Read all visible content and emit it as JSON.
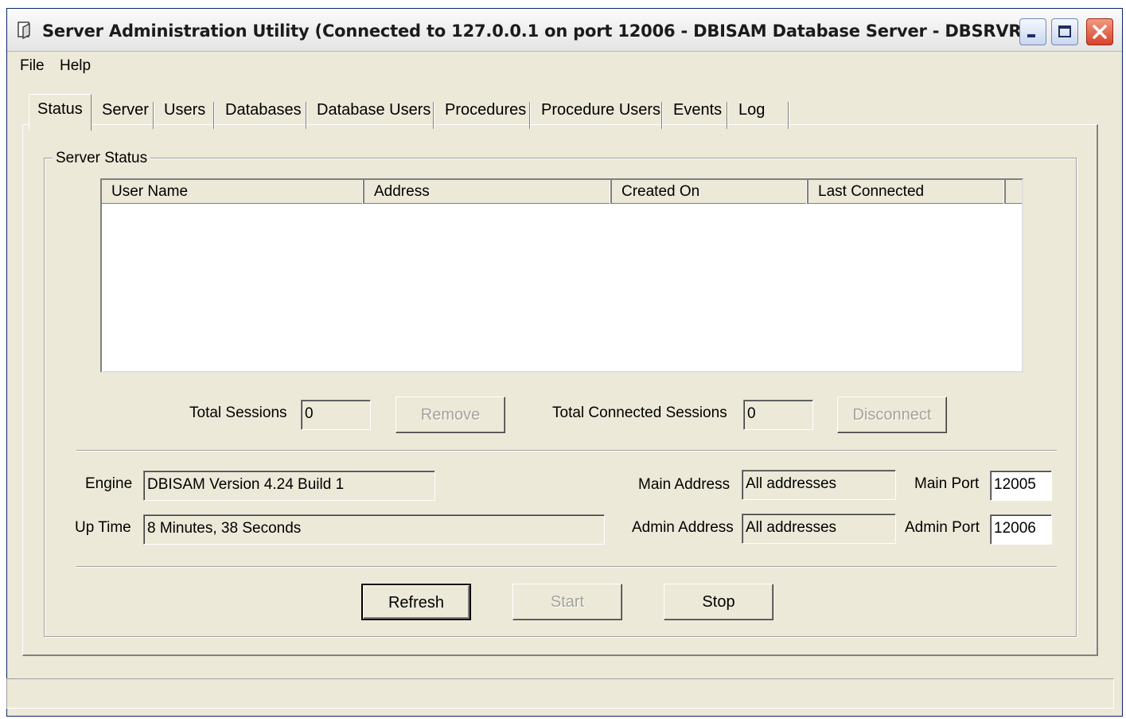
{
  "window": {
    "title": "Server Administration Utility (Connected to 127.0.0.1 on port 12006 - DBISAM Database Server - DBSRVR ...",
    "controls": {
      "minimize_icon": "minimize-icon",
      "maximize_icon": "maximize-icon",
      "close_icon": "close-icon"
    }
  },
  "menu": {
    "file": "File",
    "help": "Help"
  },
  "tabs": [
    "Status",
    "Server",
    "Users",
    "Databases",
    "Database Users",
    "Procedures",
    "Procedure Users",
    "Events",
    "Log"
  ],
  "status": {
    "group_label": "Server Status",
    "columns": [
      "User Name",
      "Address",
      "Created On",
      "Last Connected"
    ],
    "rows": [],
    "total_sessions_label": "Total Sessions",
    "total_sessions_value": "0",
    "remove_label": "Remove",
    "total_connected_label": "Total Connected Sessions",
    "total_connected_value": "0",
    "disconnect_label": "Disconnect",
    "engine_label": "Engine",
    "engine_value": "DBISAM Version 4.24 Build 1",
    "uptime_label": "Up Time",
    "uptime_value": "8 Minutes, 38 Seconds",
    "main_address_label": "Main Address",
    "main_address_value": "All addresses",
    "main_port_label": "Main Port",
    "main_port_value": "12005",
    "admin_address_label": "Admin Address",
    "admin_address_value": "All addresses",
    "admin_port_label": "Admin Port",
    "admin_port_value": "12006",
    "refresh_label": "Refresh",
    "start_label": "Start",
    "stop_label": "Stop"
  },
  "colors": {
    "face": "#ece9d8",
    "close_button": "#d8422a",
    "disabled_text": "#a3a399"
  }
}
